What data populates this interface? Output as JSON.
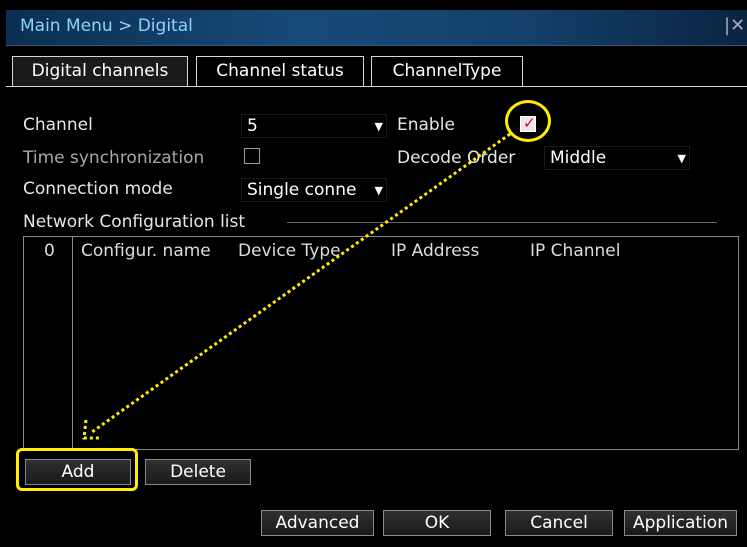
{
  "window": {
    "title": "Main Menu > Digital",
    "close_icon": "close-icon"
  },
  "tabs": [
    {
      "label": "Digital channels",
      "active": true
    },
    {
      "label": "Channel status",
      "active": false
    },
    {
      "label": "ChannelType",
      "active": false
    }
  ],
  "form": {
    "channel_label": "Channel",
    "channel_value": "5",
    "enable_label": "Enable",
    "enable_checked": true,
    "time_sync_label": "Time synchronization",
    "time_sync_checked": false,
    "decode_order_label": "Decode Order",
    "decode_order_value": "Middle",
    "connection_mode_label": "Connection mode",
    "connection_mode_value": "Single conne"
  },
  "network_list": {
    "section_label": "Network Configuration list",
    "columns": [
      "0",
      "Configur. name",
      "Device Type",
      "IP Address",
      "IP Channel"
    ],
    "rows": []
  },
  "buttons": {
    "add": "Add",
    "delete": "Delete",
    "advanced": "Advanced",
    "ok": "OK",
    "cancel": "Cancel",
    "application": "Application"
  },
  "annotation": {
    "highlight_color": "#ffee00"
  }
}
